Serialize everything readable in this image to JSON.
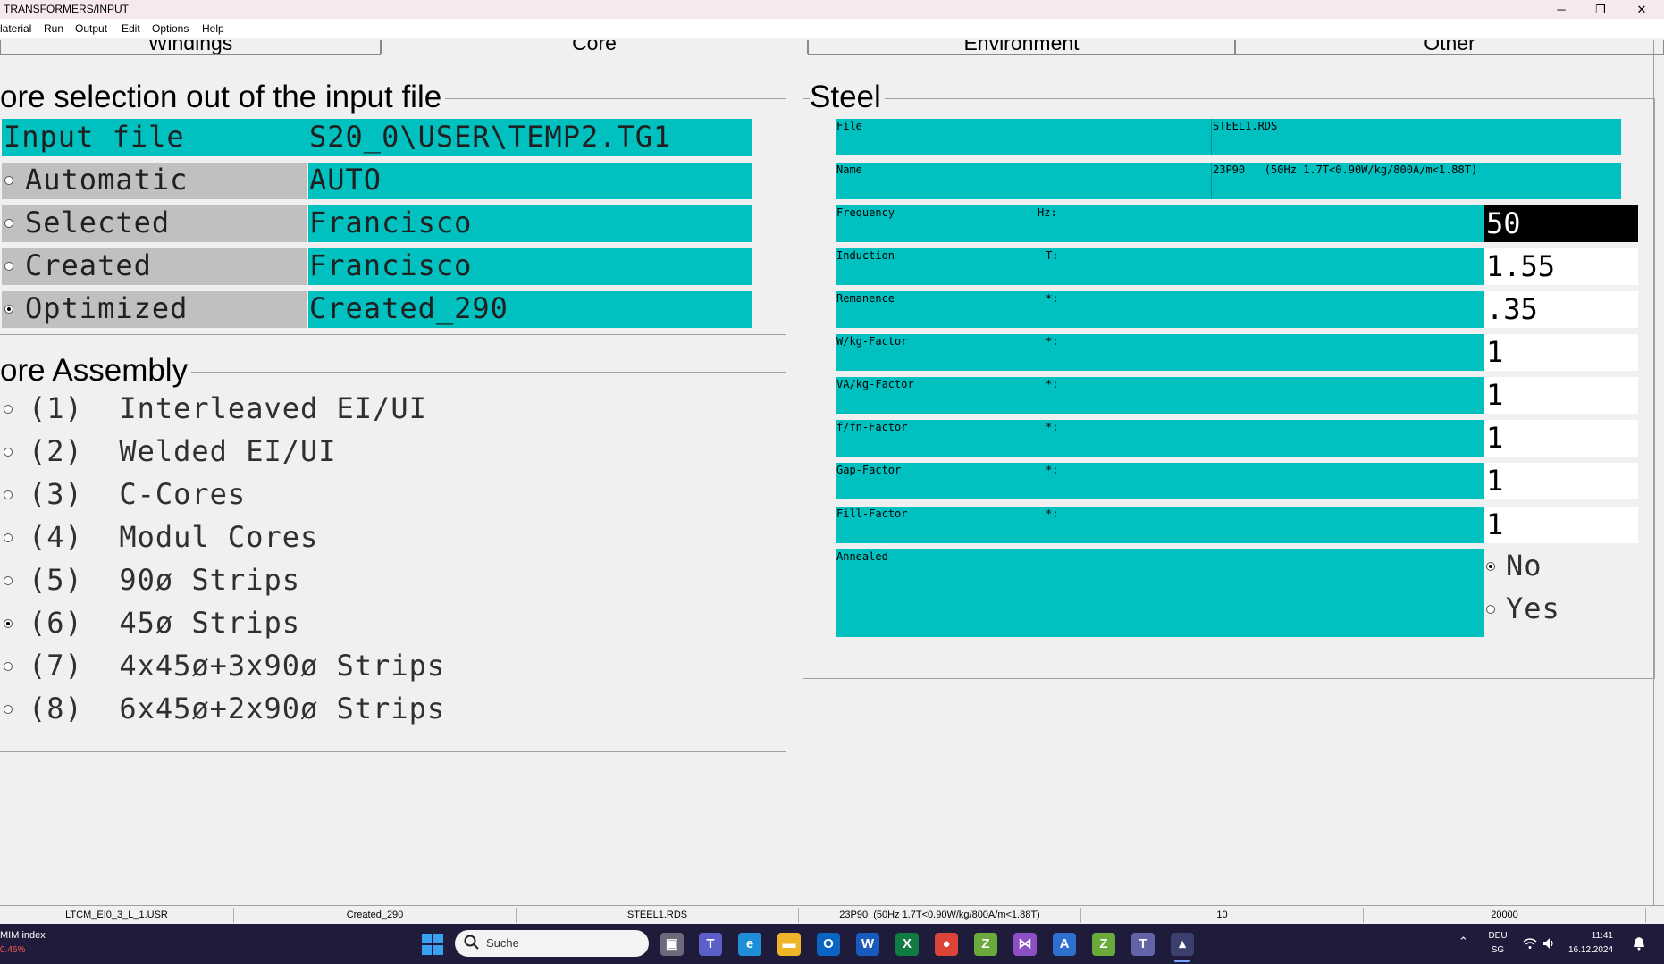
{
  "window": {
    "title": "TRANSFORMERS/INPUT",
    "minimize": "─",
    "maximize": "❐",
    "close": "✕"
  },
  "menu": [
    "laterial",
    "Run",
    "Output",
    "Edit",
    "Options",
    "Help"
  ],
  "tabs": [
    "Windings",
    "Core",
    "Environment",
    "Other"
  ],
  "active_tab": "Core",
  "core_selection": {
    "title": "ore selection out of the input file",
    "input_file": {
      "label": "Input file",
      "value": "S20_0\\USER\\TEMP2.TG1"
    },
    "options": [
      {
        "label": "Automatic",
        "value": "AUTO",
        "selected": false
      },
      {
        "label": "Selected",
        "value": "Francisco",
        "selected": false
      },
      {
        "label": "Created",
        "value": "Francisco",
        "selected": false
      },
      {
        "label": "Optimized",
        "value": "Created_290",
        "selected": true
      }
    ]
  },
  "core_assembly": {
    "title": "ore Assembly",
    "options": [
      {
        "label": "(1)  Interleaved EI/UI",
        "selected": false
      },
      {
        "label": "(2)  Welded EI/UI",
        "selected": false
      },
      {
        "label": "(3)  C-Cores",
        "selected": false
      },
      {
        "label": "(4)  Modul Cores",
        "selected": false
      },
      {
        "label": "(5)  90ø Strips",
        "selected": false
      },
      {
        "label": "(6)  45ø Strips",
        "selected": true
      },
      {
        "label": "(7)  4x45ø+3x90ø Strips",
        "selected": false
      },
      {
        "label": "(8)  6x45ø+2x90ø Strips",
        "selected": false
      }
    ]
  },
  "steel": {
    "title": "Steel",
    "file": {
      "label": "File",
      "value": "STEEL1.RDS"
    },
    "name": {
      "label": "Name",
      "value": "23P90   (50Hz 1.7T<0.90W/kg/800A/m<1.88T)"
    },
    "params": [
      {
        "label": "Frequency",
        "unit": "Hz:",
        "value": "50",
        "active": true
      },
      {
        "label": "Induction",
        "unit": "T:",
        "value": "1.55",
        "active": false
      },
      {
        "label": "Remanence",
        "unit": "*:",
        "value": ".35",
        "active": false
      },
      {
        "label": "W/kg-Factor",
        "unit": "*:",
        "value": "1",
        "active": false
      },
      {
        "label": "VA/kg-Factor",
        "unit": "*:",
        "value": "1",
        "active": false
      },
      {
        "label": "f/fn-Factor",
        "unit": "*:",
        "value": "1",
        "active": false
      },
      {
        "label": "Gap-Factor",
        "unit": "*:",
        "value": "1",
        "active": false
      },
      {
        "label": "Fill-Factor",
        "unit": "*:",
        "value": "1",
        "active": false
      }
    ],
    "annealed": {
      "label": "Annealed",
      "options": [
        {
          "label": "No",
          "selected": true
        },
        {
          "label": "Yes",
          "selected": false
        }
      ]
    }
  },
  "statusbar": [
    "LTCM_EI0_3_L_1.USR",
    "Created_290",
    "STEEL1.RDS",
    "23P90  (50Hz 1.7T<0.90W/kg/800A/m<1.88T)",
    "10",
    "20000"
  ],
  "taskbar": {
    "widget_title": "MIM index",
    "widget_value": "0.46%",
    "search_placeholder": "Suche",
    "lang_top": "DEU",
    "lang_bottom": "SG",
    "time": "11:41",
    "date": "16.12.2024",
    "apps": [
      {
        "name": "task-view",
        "glyph": "▣",
        "color": "#6b6b7b"
      },
      {
        "name": "teams",
        "glyph": "T",
        "color": "#5b5fc7"
      },
      {
        "name": "edge",
        "glyph": "e",
        "color": "#1e8fd6"
      },
      {
        "name": "file-explorer",
        "glyph": "▬",
        "color": "#f0b429"
      },
      {
        "name": "outlook",
        "glyph": "O",
        "color": "#0a64c2"
      },
      {
        "name": "word",
        "glyph": "W",
        "color": "#185abd"
      },
      {
        "name": "excel",
        "glyph": "X",
        "color": "#107c41"
      },
      {
        "name": "chrome",
        "glyph": "●",
        "color": "#db4437"
      },
      {
        "name": "app-z1",
        "glyph": "Z",
        "color": "#6aaa3a"
      },
      {
        "name": "visual-studio",
        "glyph": "⋈",
        "color": "#8d4fc4"
      },
      {
        "name": "app-a",
        "glyph": "A",
        "color": "#2f6fd0"
      },
      {
        "name": "app-z2",
        "glyph": "Z",
        "color": "#6aaa3a"
      },
      {
        "name": "teams-classic",
        "glyph": "T",
        "color": "#6264a7"
      },
      {
        "name": "active-app",
        "glyph": "▴",
        "color": "#3a3f6e"
      }
    ]
  }
}
